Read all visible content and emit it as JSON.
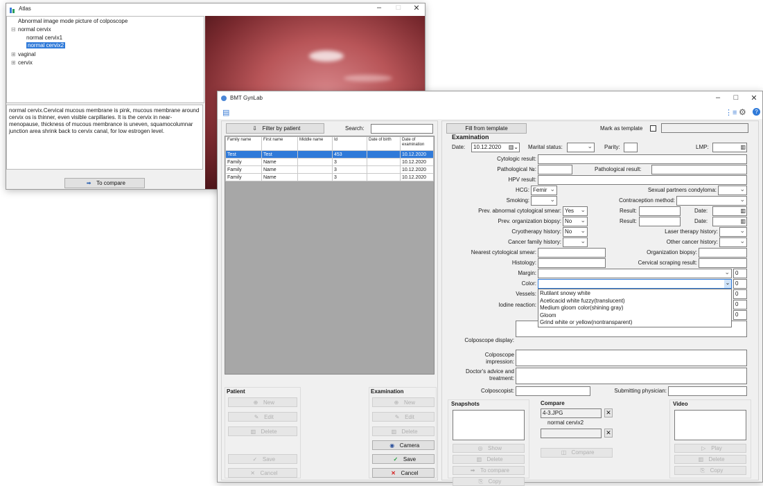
{
  "atlas": {
    "title": "Atlas",
    "tree": [
      "Abnormal image mode picture of  colposcope",
      "normal cervix",
      "normal cervix1",
      "normal cervix2",
      "vaginal",
      "cervix"
    ],
    "selected_index": 3,
    "description": "normal cervix.Cervical mucous membrane is pink, mucous membrane around cervix os is thinner, even visible carpillaries. It is the cervix in near-menopause, thickness of mucous membrance is uneven, squamocolumnar junction area shrink back to cervix canal, for low estrogen level.",
    "compare_btn": "To compare"
  },
  "main": {
    "title": "BMT GynLab",
    "left": {
      "filter_btn": "Filter by patient",
      "search_label": "Search:",
      "columns": [
        "Family name",
        "First name",
        "Middle name",
        "Id",
        "Date of birth",
        "Date of examination"
      ],
      "rows": [
        [
          "Test",
          "Test",
          "",
          "453",
          "",
          "10.12.2020"
        ],
        [
          "Family",
          "Name",
          "",
          "3",
          "",
          "10.12.2020"
        ],
        [
          "Family",
          "Name",
          "",
          "3",
          "",
          "10.12.2020"
        ],
        [
          "Family",
          "Name",
          "",
          "3",
          "",
          "10.12.2020"
        ]
      ],
      "patient": {
        "title": "Patient",
        "new": "New",
        "edit": "Edit",
        "delete": "Delete",
        "save": "Save",
        "cancel": "Cancel"
      },
      "examination": {
        "title": "Examination",
        "new": "New",
        "edit": "Edit",
        "delete": "Delete",
        "camera": "Camera",
        "save": "Save",
        "cancel": "Cancel"
      }
    },
    "right": {
      "fill_btn": "Fill from template",
      "mark_template": "Mark as template",
      "section": "Examination",
      "date_label": "Date:",
      "date_value": "10.12.2020",
      "marital": "Marital status:",
      "parity": "Parity:",
      "lmp": "LMP:",
      "cytologic": "Cytologic result:",
      "path_no": "Pathological №:",
      "path_result": "Pathological result:",
      "hpv": "HPV result:",
      "hcg": "HCG:",
      "hcg_value": "Femir",
      "sexual": "Sexual partners condyloma:",
      "smoking": "Smoking:",
      "contraception": "Contraception method:",
      "prev_smear": "Prev. abnormal cytological smear:",
      "prev_smear_value": "Yes",
      "result": "Result:",
      "date": "Date:",
      "prev_biopsy": "Prev. organization biopsy:",
      "prev_biopsy_value": "No",
      "cryo": "Cryotherapy history:",
      "cryo_value": "No",
      "laser": "Laser therapy history:",
      "cancer_family": "Cancer family history:",
      "other_cancer": "Other cancer history:",
      "nearest": "Nearest cytological smear:",
      "org_biopsy": "Organization biopsy:",
      "histology": "Histology:",
      "scraping": "Cervical scraping result:",
      "margin": "Margin:",
      "color": "Color:",
      "vessels": "Vessels:",
      "iodine": "Iodine reaction:",
      "zero": "0",
      "color_options": [
        "Rutilant snowy white",
        "Aceticacid white fuzzy(translucent)",
        "Medium gloom color(shining gray)",
        "Gloom",
        "Grind white or yellow(nontransparent)"
      ],
      "colpo_display": "Colposcope display:",
      "colpo_impression": "Colposcope impression:",
      "advice": "Doctor's advice and treatment:",
      "colposcopist": "Colposcopist:",
      "submitting": "Submitting physician:",
      "snapshots": {
        "title": "Snapshots",
        "show": "Show",
        "delete": "Delete",
        "to_compare": "To compare",
        "copy": "Copy"
      },
      "compare": {
        "title": "Compare",
        "file": "4-3.JPG",
        "caption": "normal cervix2",
        "compare_btn": "Compare"
      },
      "video": {
        "title": "Video",
        "play": "Play",
        "delete": "Delete",
        "copy": "Copy"
      }
    }
  }
}
